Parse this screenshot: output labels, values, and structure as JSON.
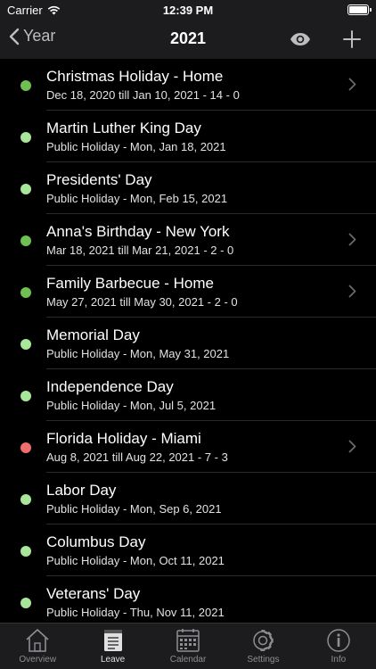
{
  "status_bar": {
    "carrier": "Carrier",
    "time": "12:39 PM"
  },
  "nav": {
    "back_label": "Year",
    "title": "2021"
  },
  "items": [
    {
      "title": "Christmas Holiday - Home",
      "subtitle": "Dec 18, 2020 till Jan 10, 2021 - 14 - 0",
      "color": "#6fbf52",
      "disclosure": true
    },
    {
      "title": "Martin Luther King Day",
      "subtitle": "Public Holiday - Mon, Jan 18, 2021",
      "color": "#a8e69a",
      "disclosure": false
    },
    {
      "title": "Presidents' Day",
      "subtitle": "Public Holiday - Mon, Feb 15, 2021",
      "color": "#a8e69a",
      "disclosure": false
    },
    {
      "title": "Anna's Birthday - New York",
      "subtitle": "Mar 18, 2021 till Mar 21, 2021 - 2 - 0",
      "color": "#6fbf52",
      "disclosure": true
    },
    {
      "title": "Family Barbecue - Home",
      "subtitle": "May 27, 2021 till May 30, 2021 - 2 - 0",
      "color": "#6fbf52",
      "disclosure": true
    },
    {
      "title": "Memorial Day",
      "subtitle": "Public Holiday - Mon, May 31, 2021",
      "color": "#a8e69a",
      "disclosure": false
    },
    {
      "title": "Independence Day",
      "subtitle": "Public Holiday - Mon, Jul 5, 2021",
      "color": "#a8e69a",
      "disclosure": false
    },
    {
      "title": "Florida Holiday - Miami",
      "subtitle": "Aug 8, 2021 till Aug 22, 2021 - 7 - 3",
      "color": "#f06d6d",
      "disclosure": true
    },
    {
      "title": "Labor Day",
      "subtitle": "Public Holiday - Mon, Sep 6, 2021",
      "color": "#a8e69a",
      "disclosure": false
    },
    {
      "title": "Columbus Day",
      "subtitle": "Public Holiday - Mon, Oct 11, 2021",
      "color": "#a8e69a",
      "disclosure": false
    },
    {
      "title": "Veterans' Day",
      "subtitle": "Public Holiday - Thu, Nov 11, 2021",
      "color": "#a8e69a",
      "disclosure": false
    }
  ],
  "tabs": [
    {
      "label": "Overview",
      "icon": "house-icon",
      "active": false
    },
    {
      "label": "Leave",
      "icon": "notepad-icon",
      "active": true
    },
    {
      "label": "Calendar",
      "icon": "calendar-icon",
      "active": false
    },
    {
      "label": "Settings",
      "icon": "gear-icon",
      "active": false
    },
    {
      "label": "Info",
      "icon": "info-icon",
      "active": false
    }
  ]
}
